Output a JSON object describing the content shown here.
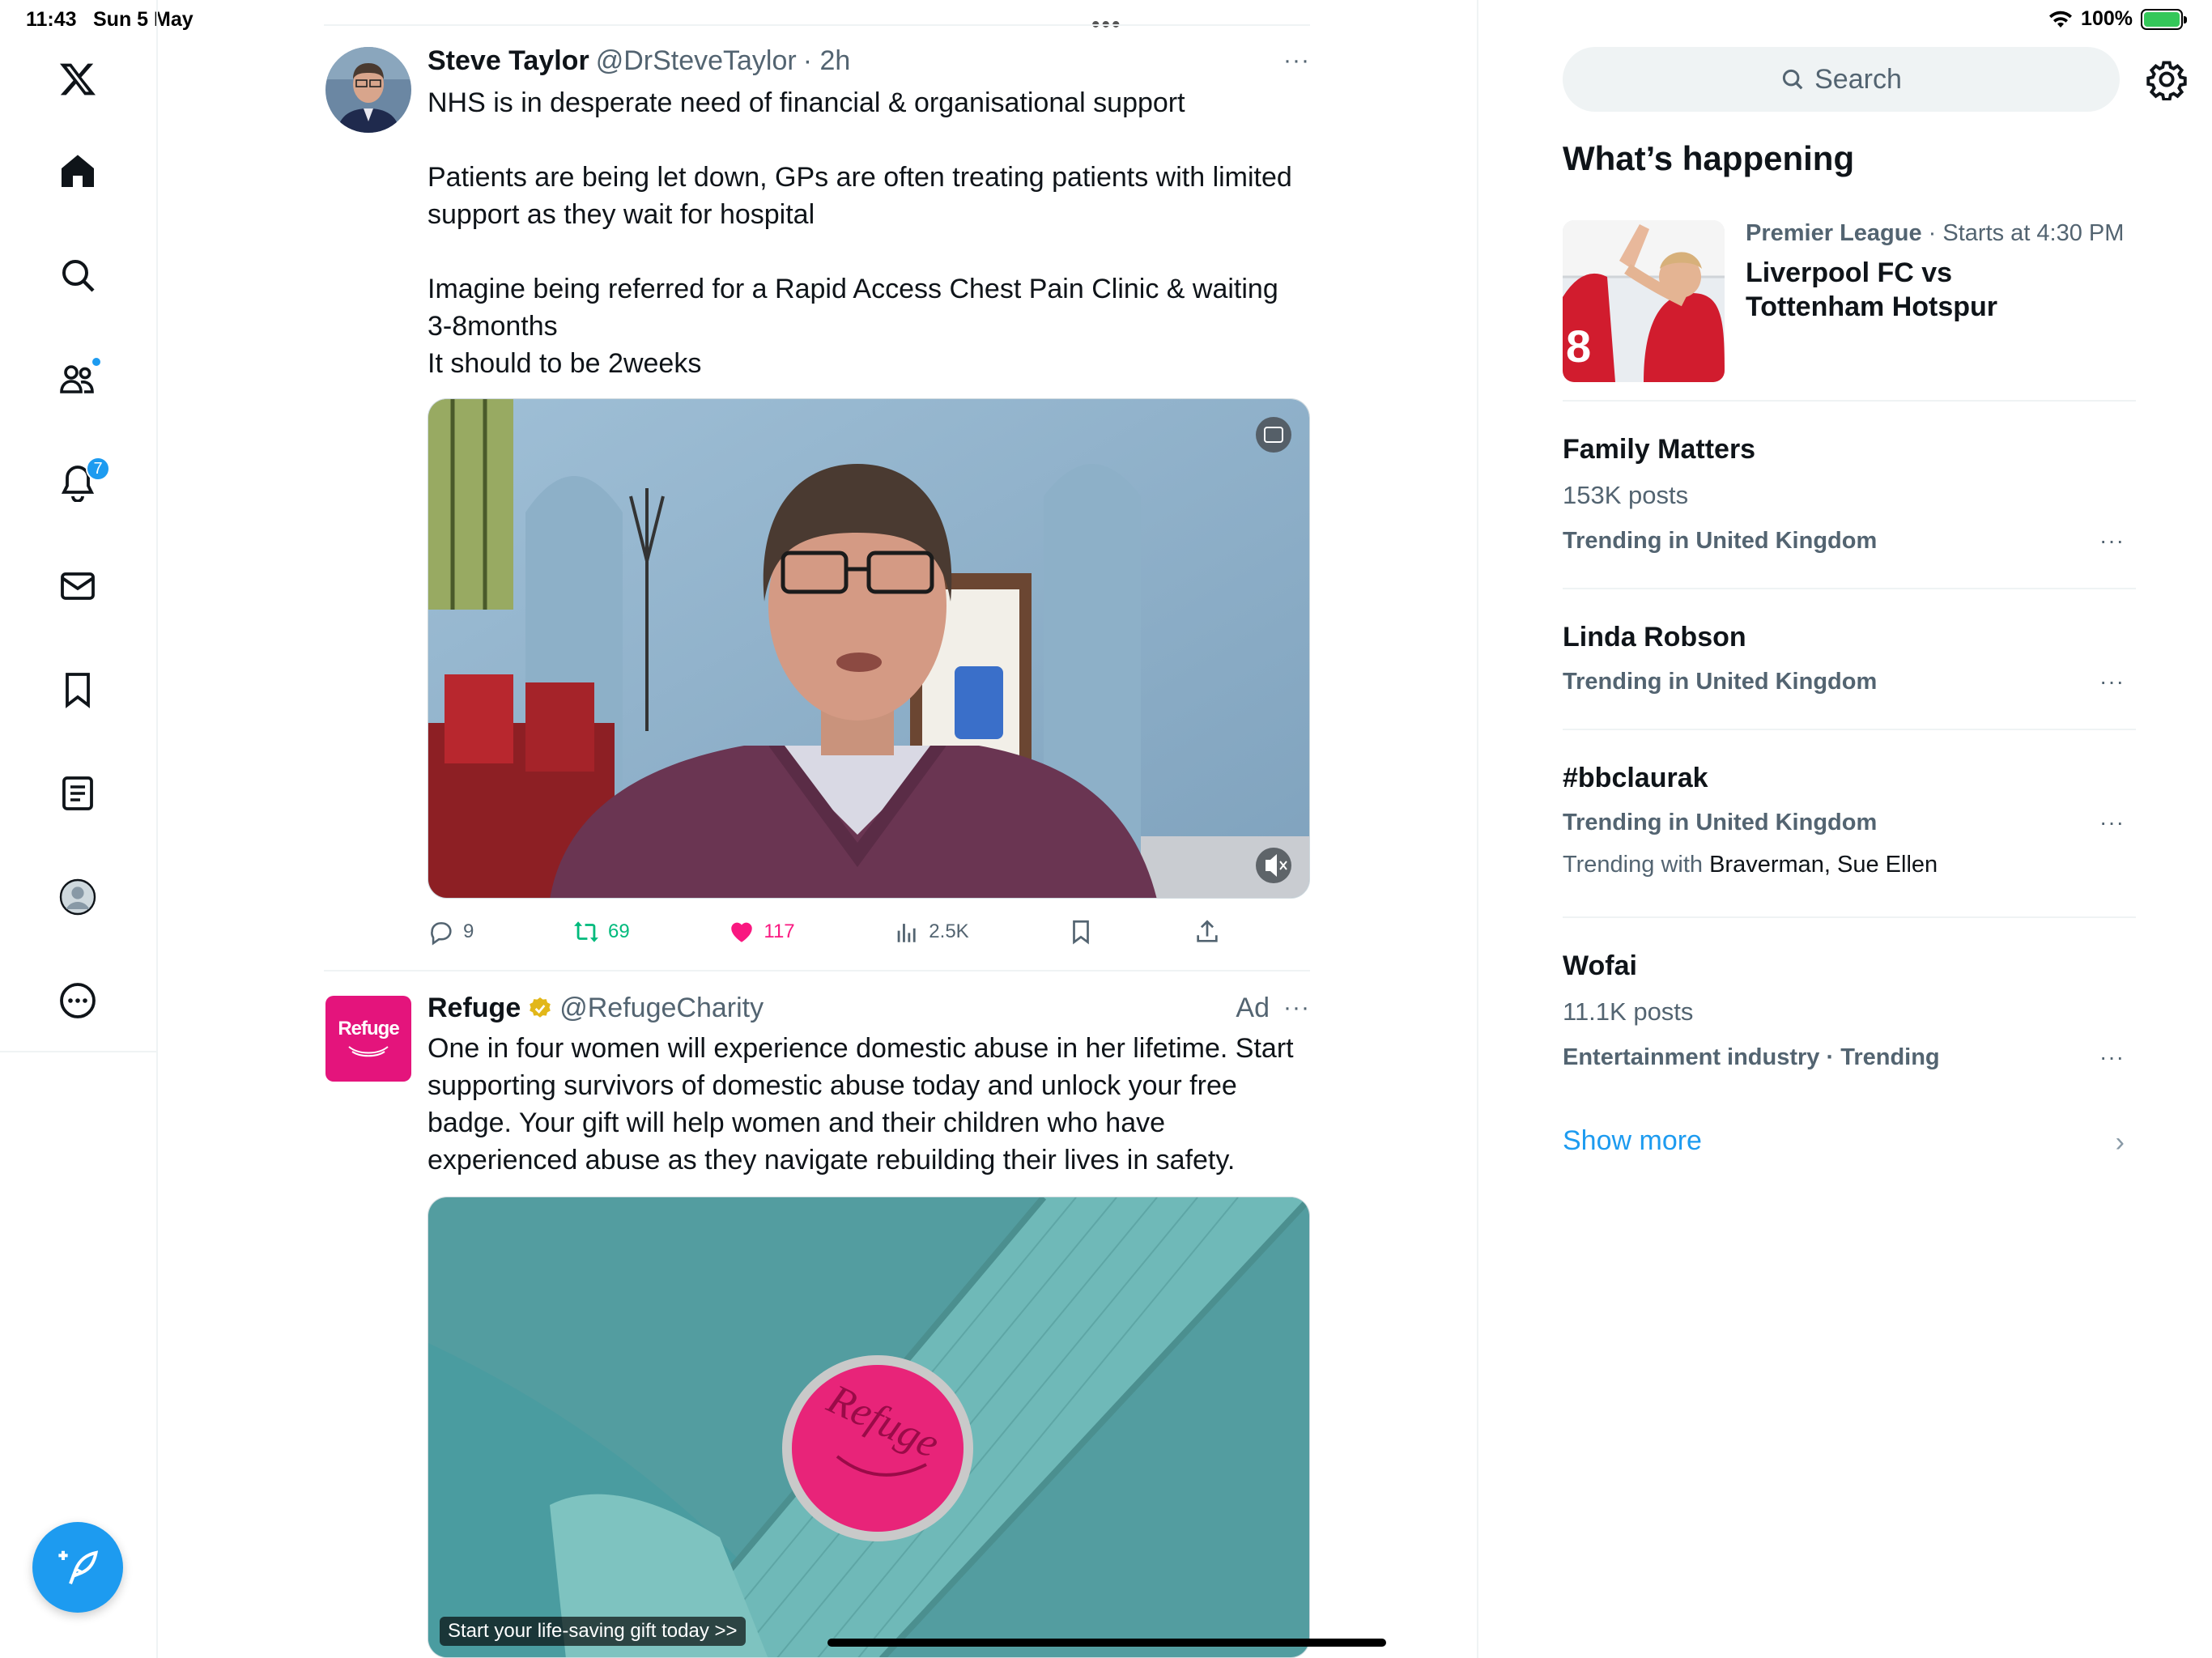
{
  "status_bar": {
    "time": "11:43",
    "date": "Sun 5 May",
    "battery": "100%",
    "multitask": "•••"
  },
  "nav": {
    "items": [
      "Home",
      "Search",
      "Communities",
      "Notifications",
      "Messages",
      "Bookmarks",
      "Lists",
      "Profile",
      "More"
    ],
    "notifications_badge": "7"
  },
  "posts": [
    {
      "name": "Steve Taylor",
      "handle": "@DrSteveTaylor",
      "time": "· 2h",
      "more": "···",
      "text_lines": [
        "NHS is in desperate need of financial & organisational support",
        "",
        "Patients are being let down, GPs are often treating patients with limited support as they wait for hospital",
        "",
        "Imagine being referred for a Rapid Access Chest Pain Clinic & waiting 3-8months",
        "It should to be 2weeks"
      ],
      "actions": {
        "replies": "9",
        "reposts": "69",
        "likes": "117",
        "views": "2.5K"
      }
    },
    {
      "name": "Refuge",
      "handle": "@RefugeCharity",
      "ad_label": "Ad",
      "more": "···",
      "logo_text": "Refuge",
      "text": "One in four women will experience domestic abuse in her lifetime. Start supporting survivors of domestic abuse today and unlock your free badge. Your gift will help women and their children who have experienced abuse as they navigate rebuilding their lives in safety.",
      "media_caption": "Start your life-saving gift today >>",
      "badge_text": "Refuge"
    }
  ],
  "sidebar": {
    "search_placeholder": "Search",
    "title": "What’s happening",
    "event": {
      "category": "Premier League",
      "meta": "· Starts at 4:30 PM",
      "title_line1": "Liverpool FC vs",
      "title_line2": "Tottenham Hotspur"
    },
    "trends": [
      {
        "name": "Family Matters",
        "count": "153K posts",
        "meta": "Trending in United Kingdom"
      },
      {
        "name": "Linda Robson",
        "meta": "Trending in United Kingdom"
      },
      {
        "name": "#bbclaurak",
        "meta": "Trending in United Kingdom",
        "with_prefix": "Trending with",
        "with_names": "Braverman, Sue Ellen"
      },
      {
        "name": "Wofai",
        "count": "11.1K posts",
        "meta": "Entertainment industry · Trending"
      }
    ],
    "trend_more": "···",
    "show_more": "Show more"
  },
  "colors": {
    "accent": "#1d9bf0",
    "like": "#f91880",
    "repost": "#00ba7c",
    "refuge_pink": "#e4147c"
  }
}
